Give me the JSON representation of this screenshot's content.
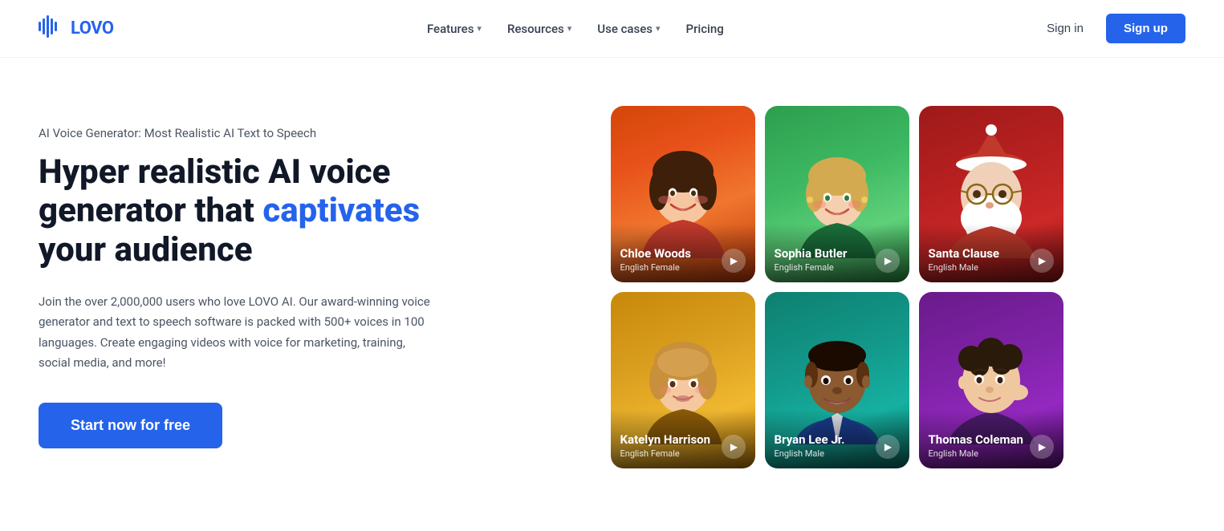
{
  "brand": {
    "name": "LOVO",
    "logo_icon": "|||"
  },
  "nav": {
    "links": [
      {
        "label": "Features",
        "has_dropdown": true
      },
      {
        "label": "Resources",
        "has_dropdown": true
      },
      {
        "label": "Use cases",
        "has_dropdown": true
      },
      {
        "label": "Pricing",
        "has_dropdown": false
      }
    ],
    "signin_label": "Sign in",
    "signup_label": "Sign up"
  },
  "hero": {
    "subtitle": "AI Voice Generator: Most Realistic AI Text to Speech",
    "title_part1": "Hyper realistic AI voice generator that ",
    "title_accent": "captivates",
    "title_part2": " your audience",
    "description": "Join the over 2,000,000 users who love LOVO AI. Our award-winning voice generator and text to speech software is packed with 500+ voices in 100 languages. Create engaging videos with voice for marketing, training, social media, and more!",
    "cta_label": "Start now for free"
  },
  "voices": [
    {
      "id": "chloe",
      "name": "Chloe Woods",
      "language": "English",
      "gender": "Female",
      "bg_class": "face-chloe"
    },
    {
      "id": "sophia",
      "name": "Sophia Butler",
      "language": "English",
      "gender": "Female",
      "bg_class": "face-sophia"
    },
    {
      "id": "santa",
      "name": "Santa Clause",
      "language": "English",
      "gender": "Male",
      "bg_class": "face-santa"
    },
    {
      "id": "katelyn",
      "name": "Katelyn Harrison",
      "language": "English",
      "gender": "Female",
      "bg_class": "face-katelyn"
    },
    {
      "id": "bryan",
      "name": "Bryan Lee Jr.",
      "language": "English",
      "gender": "Male",
      "bg_class": "face-bryan"
    },
    {
      "id": "thomas",
      "name": "Thomas Coleman",
      "language": "English",
      "gender": "Male",
      "bg_class": "face-thomas"
    }
  ]
}
